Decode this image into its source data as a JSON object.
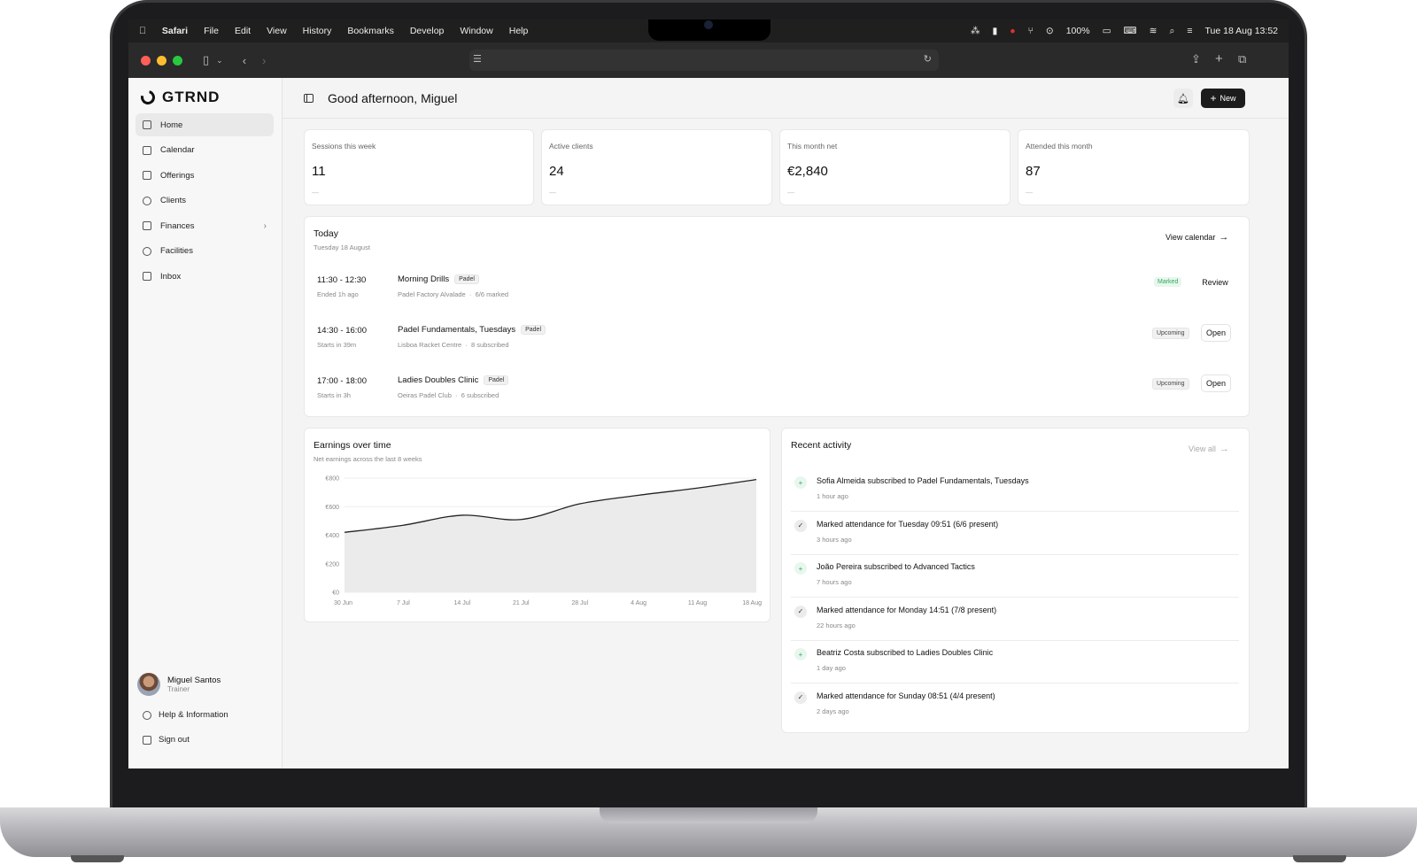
{
  "menubar": {
    "app": "Safari",
    "items": [
      "File",
      "Edit",
      "View",
      "History",
      "Bookmarks",
      "Develop",
      "Window",
      "Help"
    ],
    "battery": "100%",
    "datetime": "Tue 18 Aug  13:52"
  },
  "brand": {
    "name": "GTRND"
  },
  "nav": [
    {
      "label": "Home",
      "icon": "home-icon",
      "active": true
    },
    {
      "label": "Calendar",
      "icon": "calendar-icon"
    },
    {
      "label": "Offerings",
      "icon": "layers-icon"
    },
    {
      "label": "Clients",
      "icon": "users-icon"
    },
    {
      "label": "Finances",
      "icon": "chart-icon",
      "chevron": "›"
    },
    {
      "label": "Facilities",
      "icon": "location-icon"
    },
    {
      "label": "Inbox",
      "icon": "inbox-icon"
    }
  ],
  "user": {
    "name": "Miguel Santos",
    "role": "Trainer"
  },
  "footer": {
    "help": "Help & Information",
    "signout": "Sign out"
  },
  "header": {
    "greeting": "Good afternoon, Miguel",
    "new_label": "New"
  },
  "stats": [
    {
      "label": "Sessions this week",
      "value": "11",
      "dash": "—"
    },
    {
      "label": "Active clients",
      "value": "24",
      "dash": "—"
    },
    {
      "label": "This month net",
      "value": "€2,840",
      "dash": "—"
    },
    {
      "label": "Attended this month",
      "value": "87",
      "dash": "—"
    }
  ],
  "today": {
    "title": "Today",
    "date": "Tuesday 18 August",
    "view_calendar": "View calendar",
    "sessions": [
      {
        "time": "11:30 - 12:30",
        "rel": "Ended 1h ago",
        "name": "Morning Drills",
        "tag": "Padel",
        "location": "Padel Factory Alvalade",
        "sep": "·",
        "detail": "6/6 marked",
        "status": "Marked",
        "action": "Review"
      },
      {
        "time": "14:30 - 16:00",
        "rel": "Starts in 39m",
        "name": "Padel Fundamentals, Tuesdays",
        "tag": "Padel",
        "location": "Lisboa Racket Centre",
        "sep": "·",
        "detail": "8 subscribed",
        "status": "Upcoming",
        "action": "Open"
      },
      {
        "time": "17:00 - 18:00",
        "rel": "Starts in 3h",
        "name": "Ladies Doubles Clinic",
        "tag": "Padel",
        "location": "Oeiras Padel Club",
        "sep": "·",
        "detail": "6 subscribed",
        "status": "Upcoming",
        "action": "Open"
      }
    ]
  },
  "earnings": {
    "title": "Earnings over time",
    "subtitle": "Net earnings across the last 8 weeks"
  },
  "chart_data": {
    "type": "area",
    "title": "Earnings over time",
    "subtitle": "Net earnings across the last 8 weeks",
    "x": [
      "30 Jun",
      "7 Jul",
      "14 Jul",
      "21 Jul",
      "28 Jul",
      "4 Aug",
      "11 Aug",
      "18 Aug"
    ],
    "y_ticks": [
      "€0",
      "€200",
      "€400",
      "€600",
      "€800"
    ],
    "ylim": [
      0,
      800
    ],
    "series": [
      {
        "values": [
          420,
          470,
          540,
          510,
          620,
          680,
          730,
          790
        ]
      }
    ],
    "grid": true,
    "color": "#222222",
    "fill": "#ebebeb"
  },
  "activity": {
    "title": "Recent activity",
    "view_all": "View all",
    "items": [
      {
        "text": "Sofia Almeida subscribed to Padel Fundamentals, Tuesdays",
        "time": "1 hour ago",
        "kind": "user-plus-icon",
        "accent": "green"
      },
      {
        "text": "Marked attendance for Tuesday 09:51 (6/6 present)",
        "time": "3 hours ago",
        "kind": "check-circle-icon",
        "accent": "gray"
      },
      {
        "text": "João Pereira subscribed to Advanced Tactics",
        "time": "7 hours ago",
        "kind": "user-plus-icon",
        "accent": "green"
      },
      {
        "text": "Marked attendance for Monday 14:51 (7/8 present)",
        "time": "22 hours ago",
        "kind": "check-circle-icon",
        "accent": "gray"
      },
      {
        "text": "Beatriz Costa subscribed to Ladies Doubles Clinic",
        "time": "1 day ago",
        "kind": "user-plus-icon",
        "accent": "green"
      },
      {
        "text": "Marked attendance for Sunday 08:51 (4/4 present)",
        "time": "2 days ago",
        "kind": "check-circle-icon",
        "accent": "gray"
      }
    ]
  }
}
